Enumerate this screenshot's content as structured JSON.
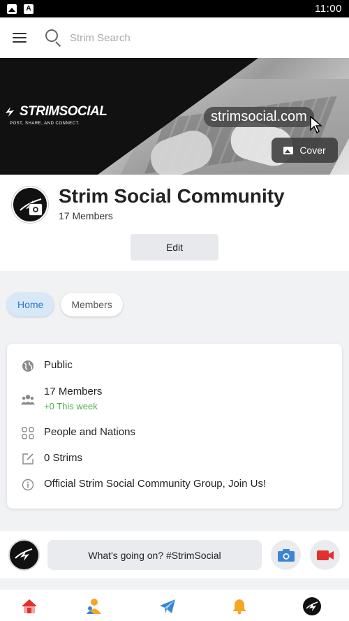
{
  "status_bar": {
    "time": "11:00",
    "icons": [
      "image-icon",
      "a-icon"
    ]
  },
  "topbar": {
    "menu_icon": "hamburger-icon",
    "search_icon": "search-icon",
    "search_placeholder": "Strim Search"
  },
  "cover": {
    "brand_name": "STRIMSOCIAL",
    "tagline": "POST, SHARE, AND CONNECT.",
    "url_text": "strimsocial.com",
    "cover_button_label": "Cover"
  },
  "group": {
    "title": "Strim Social Community",
    "members": "17 Members",
    "edit_label": "Edit"
  },
  "tabs": [
    {
      "label": "Home",
      "active": true
    },
    {
      "label": "Members",
      "active": false
    }
  ],
  "info": {
    "privacy": "Public",
    "members": "17 Members",
    "members_weekly": "+0 This week",
    "category": "People and Nations",
    "strims": "0 Strims",
    "description": "Official Strim Social Community Group, Join Us!"
  },
  "composer": {
    "placeholder": "What's going on? #StrimSocial"
  },
  "bottom_nav": [
    "home-icon",
    "people-icon",
    "send-icon",
    "bell-icon",
    "strim-logo-icon"
  ],
  "colors": {
    "accent_blue": "#2f77c4",
    "tab_active_bg": "#d7e8f8",
    "green": "#4caf50",
    "video_red": "#e0312f",
    "camera_blue": "#3b86d1"
  }
}
